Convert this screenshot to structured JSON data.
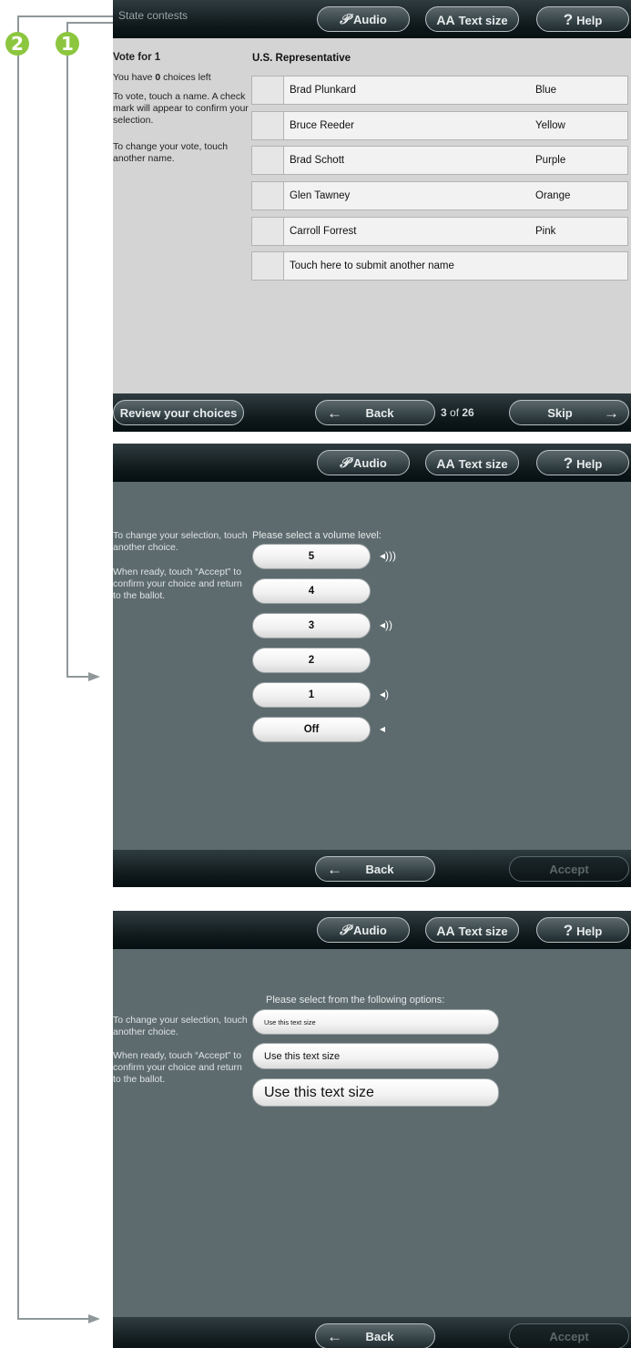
{
  "callouts": {
    "badge_1": "1",
    "badge_2": "2"
  },
  "header": {
    "title": "State contests",
    "audio_label": "Audio",
    "text_size_label": "Text size",
    "text_size_prefix": "AA",
    "help_label": "Help",
    "help_prefix": "?"
  },
  "ballot": {
    "contest_title": "U.S. Representative",
    "vote_for": "Vote for 1",
    "choices_left_prefix": "You have ",
    "choices_left_count": "0",
    "choices_left_suffix": " choices left",
    "instruction_1": "To vote, touch a name. A check mark will appear to confirm your selection.",
    "instruction_2": "To change your vote, touch another name.",
    "candidates": [
      {
        "name": "Brad Plunkard",
        "party": "Blue"
      },
      {
        "name": "Bruce Reeder",
        "party": "Yellow"
      },
      {
        "name": "Brad Schott",
        "party": "Purple"
      },
      {
        "name": "Glen Tawney",
        "party": "Orange"
      },
      {
        "name": "Carroll Forrest",
        "party": "Pink"
      }
    ],
    "write_in": "Touch here to submit another name",
    "footer": {
      "review_label": "Review your choices",
      "back_label": "Back",
      "page_current": "3",
      "page_sep": " of ",
      "page_total": "26",
      "skip_label": "Skip"
    }
  },
  "volume": {
    "prompt": "Please select a volume level:",
    "instruction_1": "To change your selection, touch another choice.",
    "instruction_2": "When ready, touch “Accept” to confirm your choice and return to the ballot.",
    "levels": [
      "5",
      "4",
      "3",
      "2",
      "1",
      "Off"
    ],
    "back_label": "Back",
    "accept_label": "Accept"
  },
  "textsize": {
    "prompt": "Please select from the following options:",
    "instruction_1": "To change your selection, touch another choice.",
    "instruction_2": "When ready, touch “Accept” to confirm your choice and return to the ballot.",
    "options": [
      "Use this text size",
      "Use this text size",
      "Use this text size"
    ],
    "back_label": "Back",
    "accept_label": "Accept"
  },
  "icons": {
    "audio": "ear-icon",
    "back": "arrow-left-icon",
    "skip": "arrow-right-icon",
    "speaker": "speaker-icon"
  },
  "colors": {
    "badge": "#8cc63f",
    "callout_line": "#8f979a",
    "panel_gray": "#5e6b6e",
    "ballot_bg": "#d4d4d4"
  }
}
